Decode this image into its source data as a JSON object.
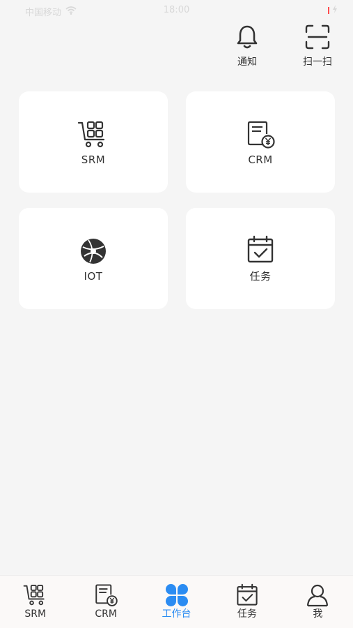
{
  "status_bar": {
    "carrier": "中国移动",
    "time": "18:00",
    "battery": ""
  },
  "top_actions": [
    {
      "label": "通知",
      "icon": "bell-icon"
    },
    {
      "label": "扫一扫",
      "icon": "scan-icon"
    }
  ],
  "cards": [
    {
      "label": "SRM",
      "icon": "cart-grid-icon"
    },
    {
      "label": "CRM",
      "icon": "document-yen-icon"
    },
    {
      "label": "IOT",
      "icon": "globe-icon"
    },
    {
      "label": "任务",
      "icon": "calendar-check-icon"
    }
  ],
  "tabbar": {
    "active_color": "#2b8cf2",
    "items": [
      {
        "label": "SRM",
        "icon": "cart-grid-icon"
      },
      {
        "label": "CRM",
        "icon": "document-yen-icon"
      },
      {
        "label": "工作台",
        "icon": "clover-icon",
        "active": true
      },
      {
        "label": "任务",
        "icon": "calendar-check-icon"
      },
      {
        "label": "我",
        "icon": "user-icon"
      }
    ]
  }
}
